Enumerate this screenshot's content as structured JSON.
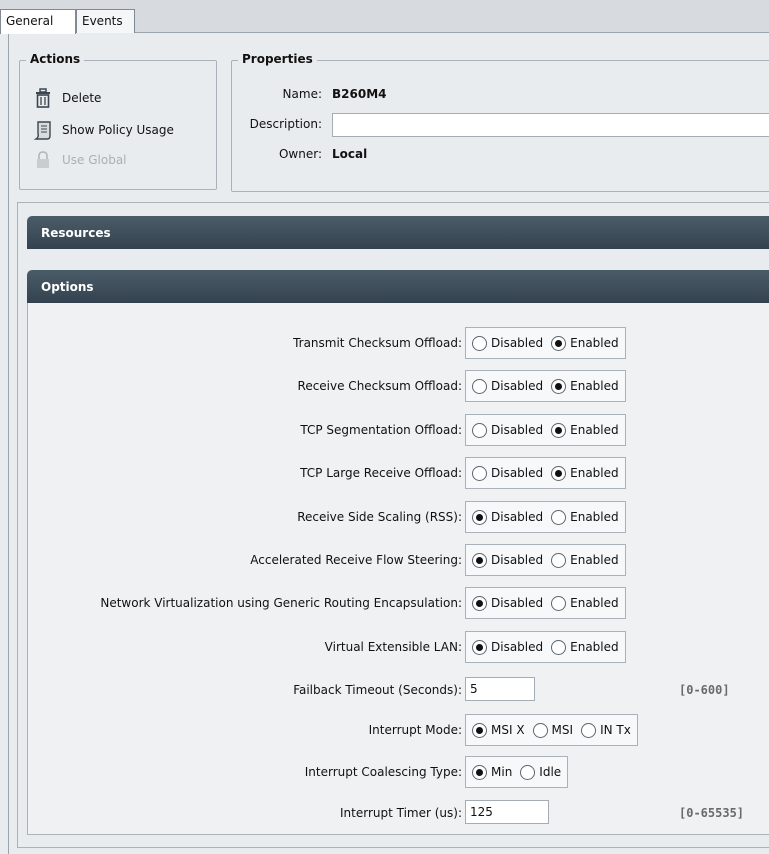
{
  "tabs": [
    {
      "label": "General",
      "active": true
    },
    {
      "label": "Events",
      "active": false
    }
  ],
  "actions": {
    "title": "Actions",
    "items": [
      {
        "label": "Delete",
        "icon": "trash-icon",
        "enabled": true
      },
      {
        "label": "Show Policy Usage",
        "icon": "scroll-icon",
        "enabled": true
      },
      {
        "label": "Use Global",
        "icon": "lock-icon",
        "enabled": false
      }
    ]
  },
  "properties": {
    "title": "Properties",
    "name_label": "Name:",
    "name_value": "B260M4",
    "description_label": "Description:",
    "description_value": "",
    "owner_label": "Owner:",
    "owner_value": "Local"
  },
  "sections": {
    "resources": "Resources",
    "options": "Options"
  },
  "options": [
    {
      "label": "Transmit Checksum Offload:",
      "choices": [
        "Disabled",
        "Enabled"
      ],
      "selected": "Enabled"
    },
    {
      "label": "Receive Checksum Offload:",
      "choices": [
        "Disabled",
        "Enabled"
      ],
      "selected": "Enabled"
    },
    {
      "label": "TCP Segmentation Offload:",
      "choices": [
        "Disabled",
        "Enabled"
      ],
      "selected": "Enabled"
    },
    {
      "label": "TCP Large Receive Offload:",
      "choices": [
        "Disabled",
        "Enabled"
      ],
      "selected": "Enabled"
    },
    {
      "label": "Receive Side Scaling (RSS):",
      "choices": [
        "Disabled",
        "Enabled"
      ],
      "selected": "Disabled"
    },
    {
      "label": "Accelerated Receive Flow Steering:",
      "choices": [
        "Disabled",
        "Enabled"
      ],
      "selected": "Disabled"
    },
    {
      "label": "Network Virtualization using Generic Routing Encapsulation:",
      "choices": [
        "Disabled",
        "Enabled"
      ],
      "selected": "Disabled"
    },
    {
      "label": "Virtual Extensible LAN:",
      "choices": [
        "Disabled",
        "Enabled"
      ],
      "selected": "Disabled"
    }
  ],
  "failback": {
    "label": "Failback Timeout (Seconds):",
    "value": "5",
    "range": "[0-600]"
  },
  "interrupt_mode": {
    "label": "Interrupt Mode:",
    "choices": [
      "MSI X",
      "MSI",
      "IN Tx"
    ],
    "selected": "MSI X"
  },
  "coalescing": {
    "label": "Interrupt Coalescing Type:",
    "choices": [
      "Min",
      "Idle"
    ],
    "selected": "Min"
  },
  "timer": {
    "label": "Interrupt Timer (us):",
    "value": "125",
    "range": "[0-65535]"
  }
}
